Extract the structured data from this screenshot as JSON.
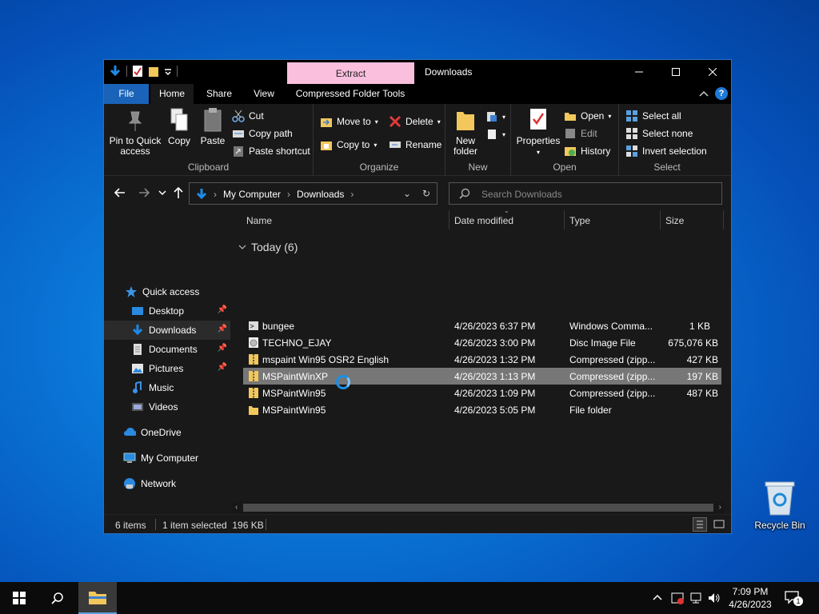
{
  "desktop": {
    "recycle_bin_label": "Recycle Bin"
  },
  "window": {
    "context_tab": "Extract",
    "title": "Downloads",
    "tabs": {
      "file": "File",
      "home": "Home",
      "share": "Share",
      "view": "View",
      "tools": "Compressed Folder Tools"
    },
    "ribbon": {
      "clipboard": {
        "name": "Clipboard",
        "pin_line1": "Pin to Quick",
        "pin_line2": "access",
        "copy": "Copy",
        "paste": "Paste",
        "cut": "Cut",
        "copy_path": "Copy path",
        "paste_shortcut": "Paste shortcut"
      },
      "organize": {
        "name": "Organize",
        "move_to": "Move to",
        "copy_to": "Copy to",
        "delete": "Delete",
        "rename": "Rename"
      },
      "new": {
        "name": "New",
        "new_folder_line1": "New",
        "new_folder_line2": "folder"
      },
      "open": {
        "name": "Open",
        "properties": "Properties",
        "open": "Open",
        "edit": "Edit",
        "history": "History"
      },
      "select": {
        "name": "Select",
        "select_all": "Select all",
        "select_none": "Select none",
        "invert": "Invert selection"
      }
    },
    "address": {
      "crumb1": "My Computer",
      "crumb2": "Downloads",
      "search_placeholder": "Search Downloads"
    },
    "nav": {
      "quick_access": "Quick access",
      "desktop": "Desktop",
      "downloads": "Downloads",
      "documents": "Documents",
      "pictures": "Pictures",
      "music": "Music",
      "videos": "Videos",
      "onedrive": "OneDrive",
      "my_computer": "My Computer",
      "network": "Network"
    },
    "columns": {
      "name": "Name",
      "date": "Date modified",
      "type": "Type",
      "size": "Size"
    },
    "group_header": "Today (6)",
    "files": [
      {
        "name": "bungee",
        "date": "4/26/2023 6:37 PM",
        "type": "Windows Comma...",
        "size": "1 KB"
      },
      {
        "name": "TECHNO_EJAY",
        "date": "4/26/2023 3:00 PM",
        "type": "Disc Image File",
        "size": "675,076 KB"
      },
      {
        "name": "mspaint Win95 OSR2 English",
        "date": "4/26/2023 1:32 PM",
        "type": "Compressed (zipp...",
        "size": "427 KB"
      },
      {
        "name": "MSPaintWinXP",
        "date": "4/26/2023 1:13 PM",
        "type": "Compressed (zipp...",
        "size": "197 KB"
      },
      {
        "name": "MSPaintWin95",
        "date": "4/26/2023 1:09 PM",
        "type": "Compressed (zipp...",
        "size": "487 KB"
      },
      {
        "name": "MSPaintWin95",
        "date": "4/26/2023 5:05 PM",
        "type": "File folder",
        "size": ""
      }
    ],
    "status": {
      "items": "6 items",
      "selected": "1 item selected  196 KB"
    }
  },
  "taskbar": {
    "time": "7:09 PM",
    "date": "4/26/2023",
    "notification_count": "1"
  }
}
